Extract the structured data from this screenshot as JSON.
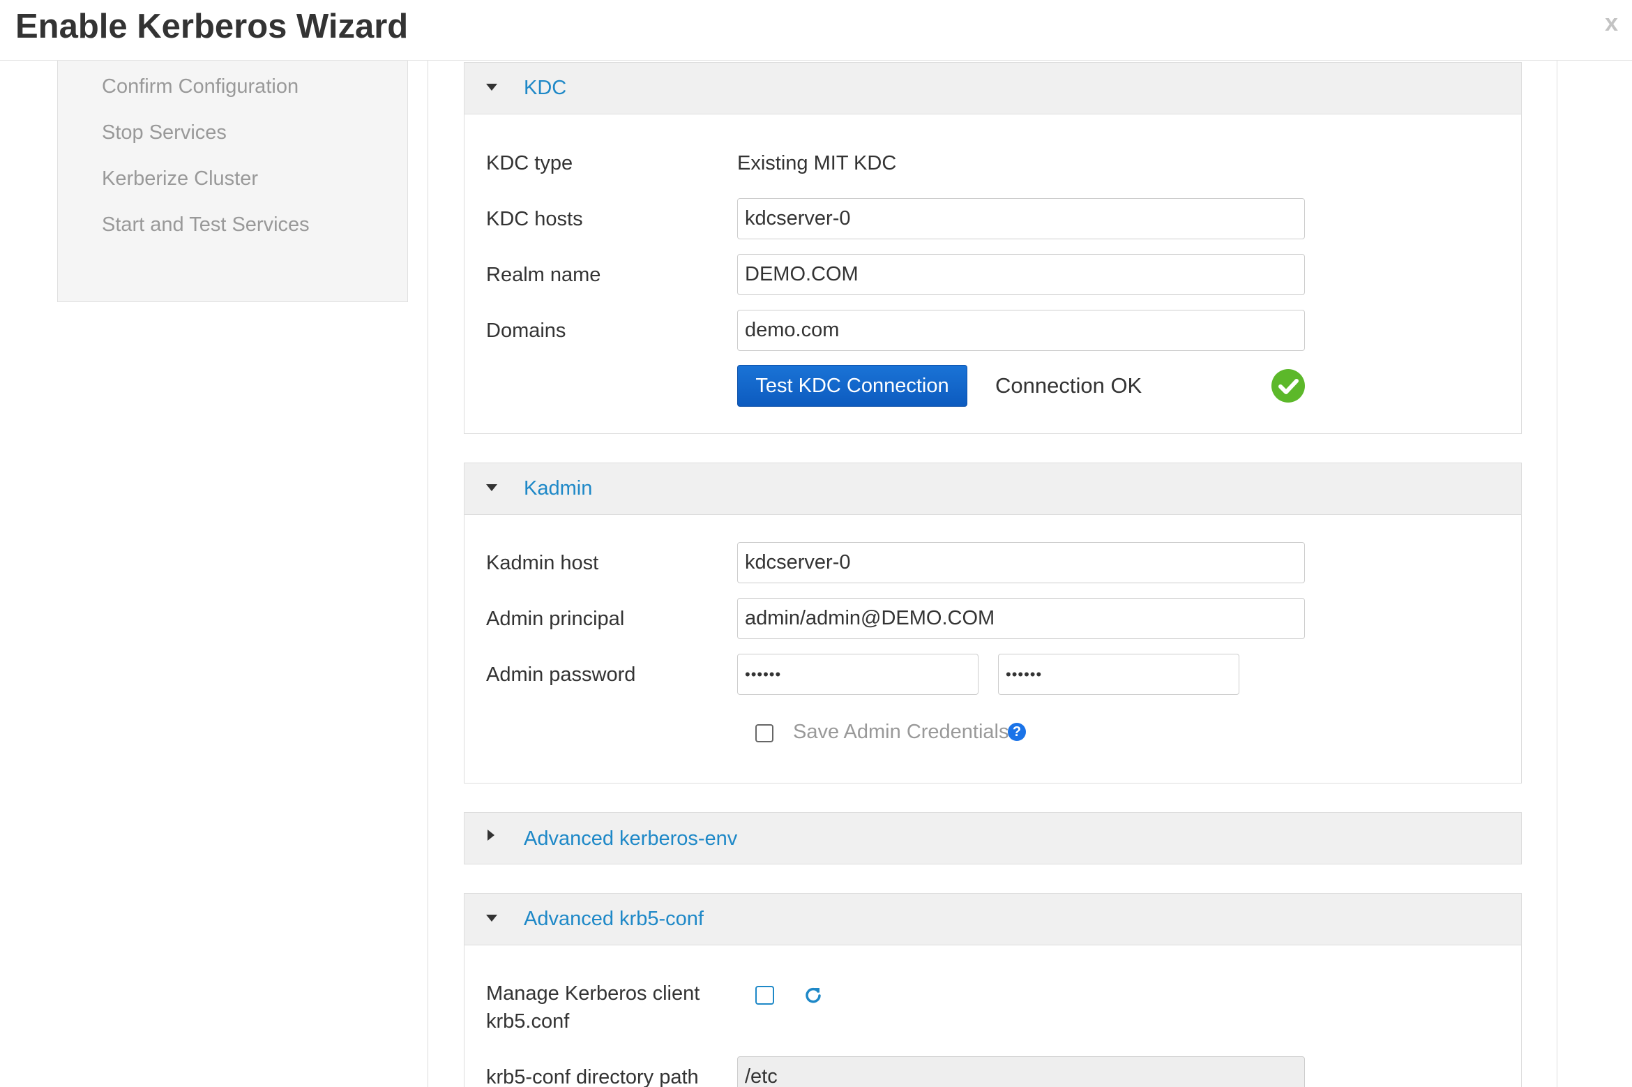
{
  "window": {
    "title": "Enable Kerberos Wizard",
    "close_label": "x"
  },
  "sidebar": {
    "items": [
      {
        "label": "Confirm Configuration"
      },
      {
        "label": "Stop Services"
      },
      {
        "label": "Kerberize Cluster"
      },
      {
        "label": "Start and Test Services"
      }
    ]
  },
  "kdc": {
    "title": "KDC",
    "type_label": "KDC type",
    "type_value": "Existing MIT KDC",
    "hosts_label": "KDC hosts",
    "hosts_value": "kdcserver-0",
    "realm_label": "Realm name",
    "realm_value": "DEMO.COM",
    "domains_label": "Domains",
    "domains_value": "demo.com",
    "test_button": "Test KDC Connection",
    "status": "Connection OK",
    "status_color": "#5cb82a"
  },
  "kadmin": {
    "title": "Kadmin",
    "host_label": "Kadmin host",
    "host_value": "kdcserver-0",
    "principal_label": "Admin principal",
    "principal_value": "admin/admin@DEMO.COM",
    "password_label": "Admin password",
    "password_value": "••••••",
    "password_confirm_value": "••••••",
    "save_creds_label": "Save Admin Credentials",
    "help_glyph": "?"
  },
  "advanced_env": {
    "title": "Advanced kerberos-env"
  },
  "advanced_krb5": {
    "title": "Advanced krb5-conf",
    "manage_label_line1": "Manage Kerberos client",
    "manage_label_line2": "krb5.conf",
    "dir_label": "krb5-conf directory path",
    "dir_value": "/etc"
  },
  "colors": {
    "link": "#1e88c7",
    "primary": "#1a73d6",
    "muted": "#999999"
  }
}
